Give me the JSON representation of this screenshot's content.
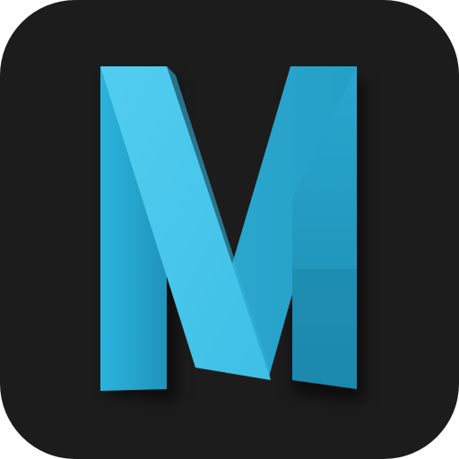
{
  "app_icon": {
    "glyph": "M",
    "icon_name": "folded-ribbon-m-logo-icon",
    "colors": {
      "background": "#1c1c1c",
      "ribbon_light": "#4cc6ea",
      "ribbon_mid": "#2aa2c8",
      "ribbon_dark": "#1e8fb3",
      "shadow": "#000000"
    }
  }
}
